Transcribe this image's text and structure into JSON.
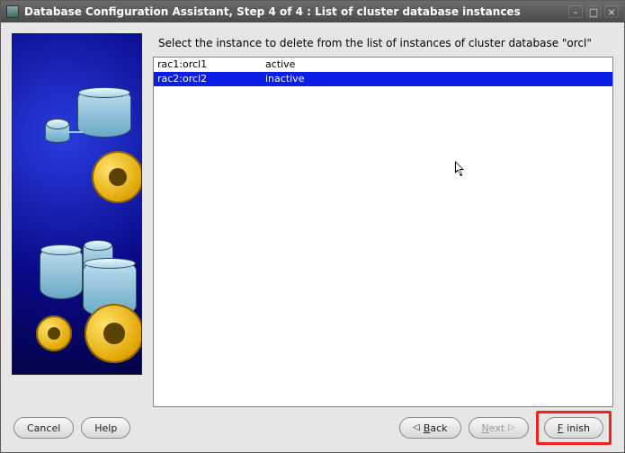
{
  "titlebar": {
    "title": "Database Configuration Assistant, Step 4 of 4 : List of cluster database instances"
  },
  "instruction": "Select the instance to delete from the list of instances of cluster database \"orcl\"",
  "instances": [
    {
      "name": "rac1:orcl1",
      "status": "active",
      "selected": false
    },
    {
      "name": "rac2:orcl2",
      "status": "inactive",
      "selected": true
    }
  ],
  "buttons": {
    "cancel": "Cancel",
    "help": "Help",
    "back": "Back",
    "next": "Next",
    "finish": "Finish"
  },
  "window_controls": {
    "minimize": "–",
    "maximize": "□",
    "close": "×"
  }
}
